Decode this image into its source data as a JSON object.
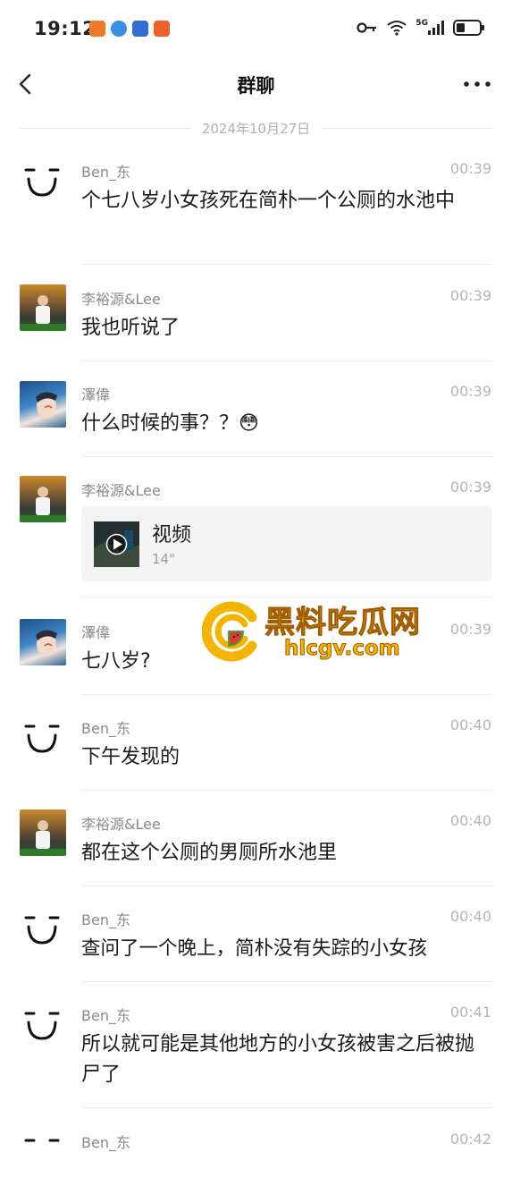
{
  "status_bar": {
    "time": "19:12",
    "network_label": "5G",
    "icons": [
      "key-icon",
      "wifi-icon",
      "signal-icon",
      "battery-icon"
    ]
  },
  "nav": {
    "title": "群聊",
    "back_icon": "chevron-left-icon",
    "more_icon": "more-dots-icon"
  },
  "date_divider": "2024年10月27日",
  "messages": [
    {
      "sender": "Ben_东",
      "time": "00:39",
      "text": "个七八岁小女孩死在简朴一个公厕的水池中",
      "avatar": "smile-face"
    },
    {
      "sender": "李裕源&Lee",
      "time": "00:39",
      "text": "我也听说了",
      "avatar": "photo-lee"
    },
    {
      "sender": "澤偉",
      "time": "00:39",
      "text": "什么时候的事？？😳",
      "avatar": "photo-zewei"
    },
    {
      "sender": "李裕源&Lee",
      "time": "00:39",
      "video": {
        "title": "视频",
        "duration": "14\""
      },
      "avatar": "photo-lee"
    },
    {
      "sender": "澤偉",
      "time": "00:39",
      "text": "七八岁?",
      "avatar": "photo-zewei"
    },
    {
      "sender": "Ben_东",
      "time": "00:40",
      "text": "下午发现的",
      "avatar": "smile-face"
    },
    {
      "sender": "李裕源&Lee",
      "time": "00:40",
      "text": "都在这个公厕的男厕所水池里",
      "avatar": "photo-lee"
    },
    {
      "sender": "Ben_东",
      "time": "00:40",
      "text": "查问了一个晚上，简朴没有失踪的小女孩",
      "avatar": "smile-face"
    },
    {
      "sender": "Ben_东",
      "time": "00:41",
      "text": "所以就可能是其他地方的小女孩被害之后被抛尸了",
      "avatar": "smile-face"
    },
    {
      "sender": "Ben_东",
      "time": "00:42",
      "text": "",
      "avatar": "smile-face"
    }
  ],
  "watermark": {
    "title": "黑料吃瓜网",
    "url": "hlcgv.com"
  },
  "colors": {
    "accent_watermark": "#f5b400",
    "divider": "#ededed",
    "meta_text": "#8a8a8a"
  }
}
